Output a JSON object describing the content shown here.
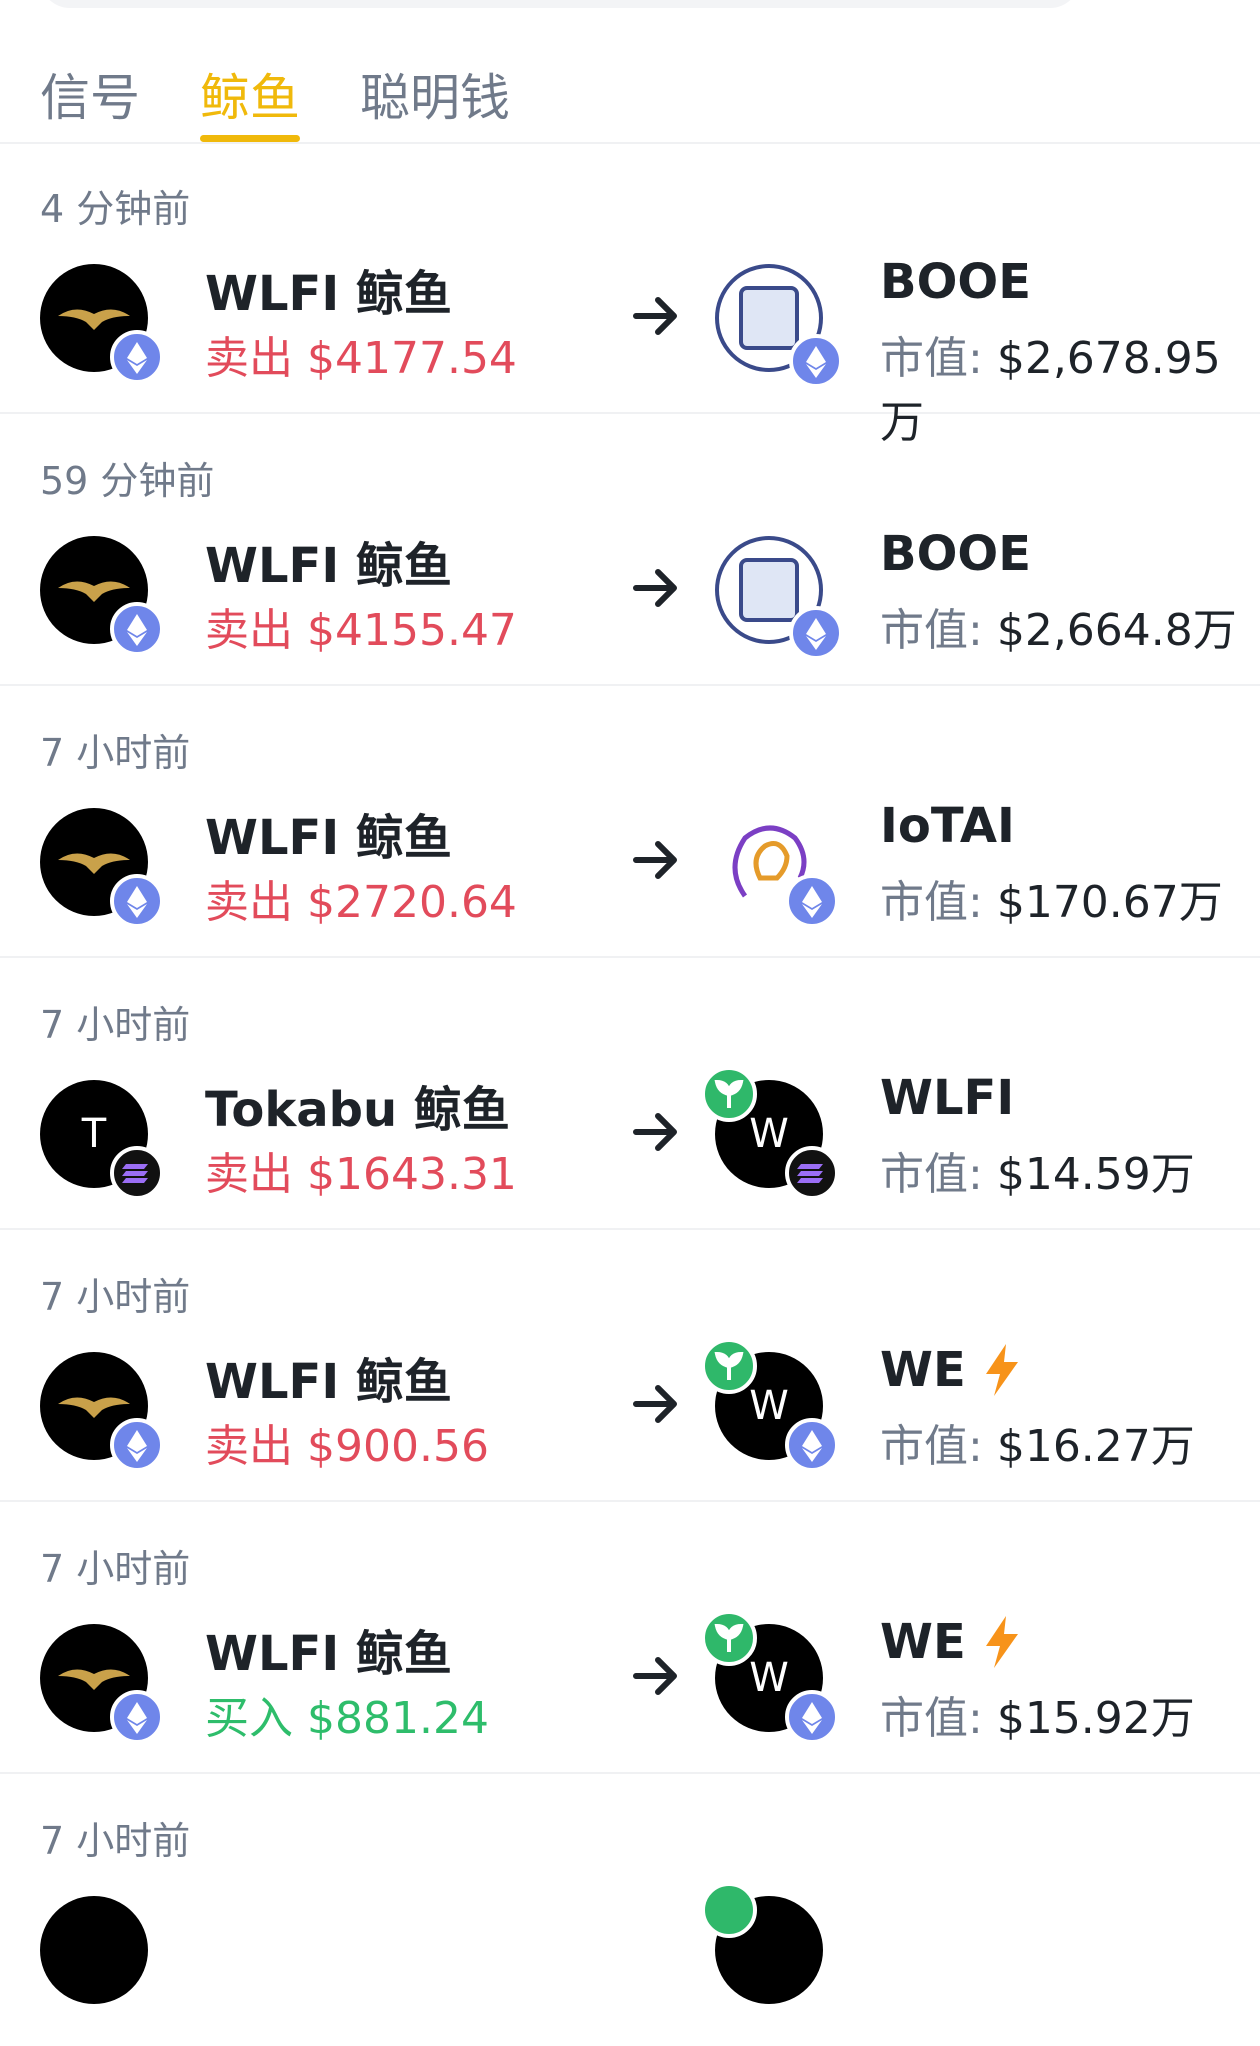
{
  "tabs": [
    {
      "label": "信号"
    },
    {
      "label": "鲸鱼",
      "active": true
    },
    {
      "label": "聪明钱"
    }
  ],
  "mcap_label": "市值:",
  "colors": {
    "accent": "#f0b90b",
    "sell": "#e24b5b",
    "buy": "#2ebd6b",
    "muted": "#707a8a"
  },
  "items": [
    {
      "time": "4 分钟前",
      "whale": "WLFI 鲸鱼",
      "action": "卖出 $4177.54",
      "token": "BOOE",
      "mcap": "$2,678.95万"
    },
    {
      "time": "59 分钟前",
      "whale": "WLFI 鲸鱼",
      "action": "卖出 $4155.47",
      "token": "BOOE",
      "mcap": "$2,664.8万"
    },
    {
      "time": "7 小时前",
      "whale": "WLFI 鲸鱼",
      "action": "卖出 $2720.64",
      "token": "IoTAI",
      "mcap": "$170.67万"
    },
    {
      "time": "7 小时前",
      "whale": "Tokabu 鲸鱼",
      "action": "卖出 $1643.31",
      "token": "WLFI",
      "mcap": "$14.59万",
      "left_letter": "T",
      "right_letter": "W"
    },
    {
      "time": "7 小时前",
      "whale": "WLFI 鲸鱼",
      "action": "卖出 $900.56",
      "token": "WE",
      "mcap": "$16.27万",
      "right_letter": "W"
    },
    {
      "time": "7 小时前",
      "whale": "WLFI 鲸鱼",
      "action": "买入 $881.24",
      "token": "WE",
      "mcap": "$15.92万",
      "right_letter": "W"
    },
    {
      "time": "7 小时前"
    }
  ]
}
